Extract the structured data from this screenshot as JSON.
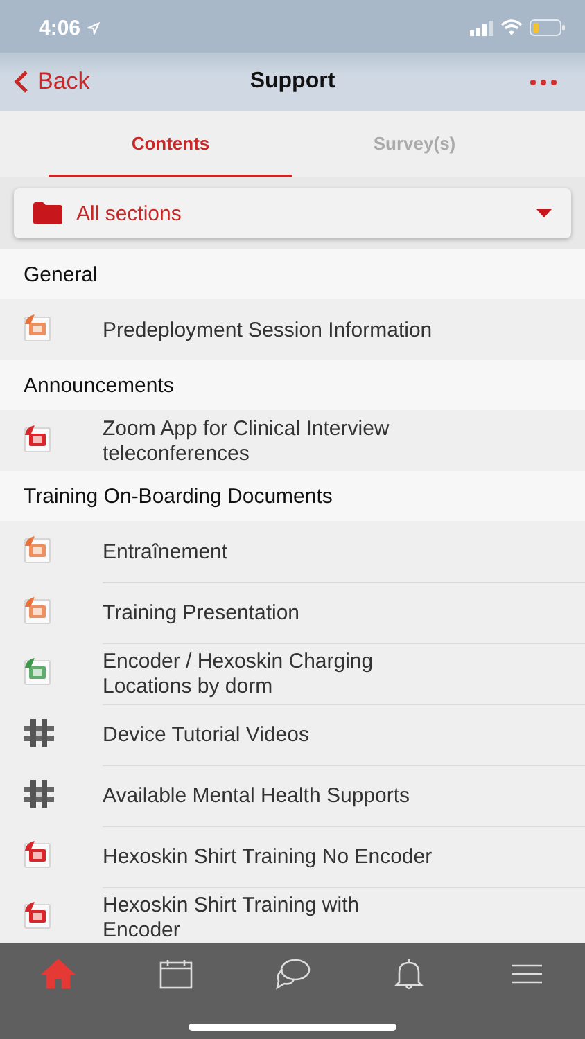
{
  "status_bar": {
    "time": "4:06"
  },
  "nav": {
    "back": "Back",
    "title": "Support"
  },
  "tabs": [
    {
      "label": "Contents",
      "selected": true
    },
    {
      "label": "Survey(s)",
      "selected": false
    }
  ],
  "section_picker": {
    "value": "All sections"
  },
  "sections": [
    {
      "title": "General",
      "items": [
        {
          "kind": "ppt",
          "label": "Predeployment Session Information"
        }
      ]
    },
    {
      "title": "Announcements",
      "items": [
        {
          "kind": "pdf",
          "label": "Zoom App for Clinical Interview teleconferences"
        }
      ]
    },
    {
      "title": "Training On-Boarding Documents",
      "items": [
        {
          "kind": "ppt",
          "label": "Entraînement"
        },
        {
          "kind": "ppt",
          "label": "Training Presentation"
        },
        {
          "kind": "xls",
          "label": "Encoder / Hexoskin Charging Locations by dorm"
        },
        {
          "kind": "grid",
          "label": "Device Tutorial Videos"
        },
        {
          "kind": "grid",
          "label": "Available Mental Health Supports"
        },
        {
          "kind": "pdf",
          "label": "Hexoskin Shirt Training No Encoder"
        },
        {
          "kind": "pdf",
          "label": "Hexoskin Shirt Training with Encoder"
        }
      ]
    }
  ],
  "bottom_tabs": [
    {
      "kind": "home",
      "selected": true
    },
    {
      "kind": "calendar",
      "selected": false
    },
    {
      "kind": "chat",
      "selected": false
    },
    {
      "kind": "bell",
      "selected": false
    },
    {
      "kind": "menu",
      "selected": false
    }
  ]
}
